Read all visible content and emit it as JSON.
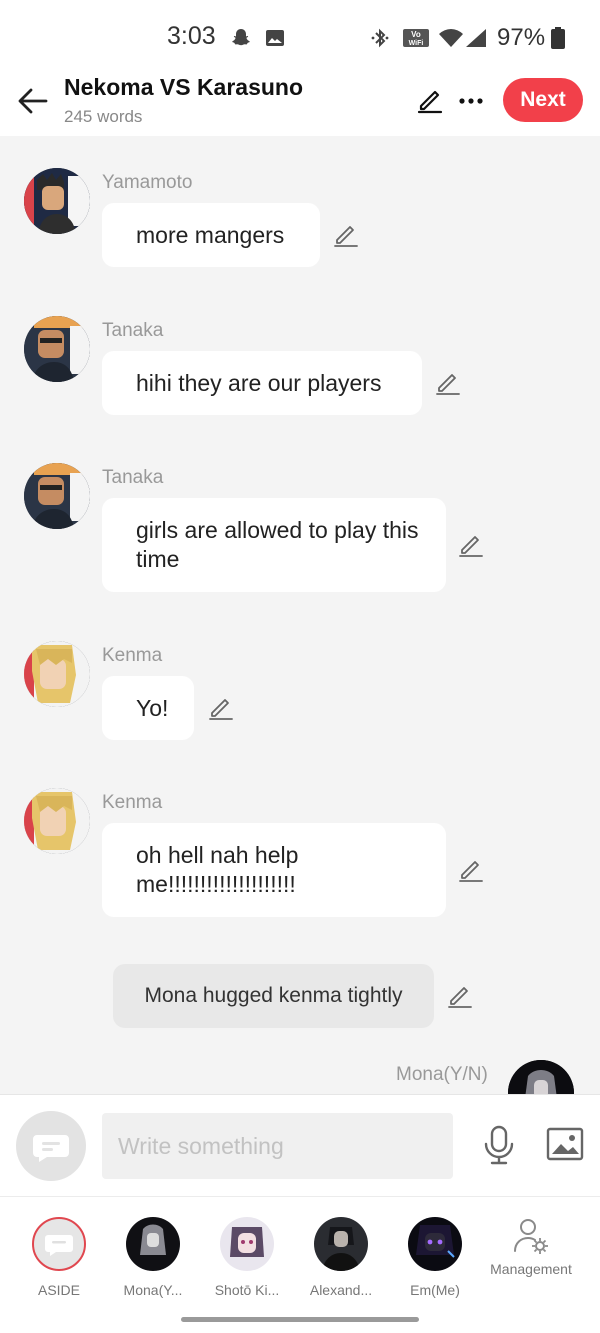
{
  "status_bar": {
    "time": "3:03",
    "battery": "97%",
    "icons": [
      "snapchat-icon",
      "gallery-icon",
      "bluetooth-icon",
      "vowifi-icon",
      "wifi-icon",
      "signal-icon",
      "battery-icon"
    ]
  },
  "header": {
    "title": "Nekoma VS Karasuno",
    "subtitle": "245 words",
    "next_label": "Next"
  },
  "messages": [
    {
      "name": "Yamamoto",
      "text": "more mangers"
    },
    {
      "name": "Tanaka",
      "text": "hihi they are our players"
    },
    {
      "name": "Tanaka",
      "text": "girls are allowed to play this time"
    },
    {
      "name": "Kenma",
      "text": "Yo!"
    },
    {
      "name": "Kenma",
      "text": "oh hell nah help me!!!!!!!!!!!!!!!!!!!!"
    }
  ],
  "aside_message": "Mona hugged kenma tightly",
  "partial_message": {
    "name": "Mona(Y/N)"
  },
  "composer": {
    "placeholder": "Write something"
  },
  "bottom_tabs": [
    {
      "label": "ASIDE"
    },
    {
      "label": "Mona(Y..."
    },
    {
      "label": "Shotō Ki..."
    },
    {
      "label": "Alexand..."
    },
    {
      "label": "Em(Me)"
    },
    {
      "label": "Management"
    }
  ],
  "colors": {
    "accent": "#f2404a",
    "background": "#f4f4f4",
    "bubble": "#ffffff",
    "aside_bubble": "#e8e8e8"
  }
}
